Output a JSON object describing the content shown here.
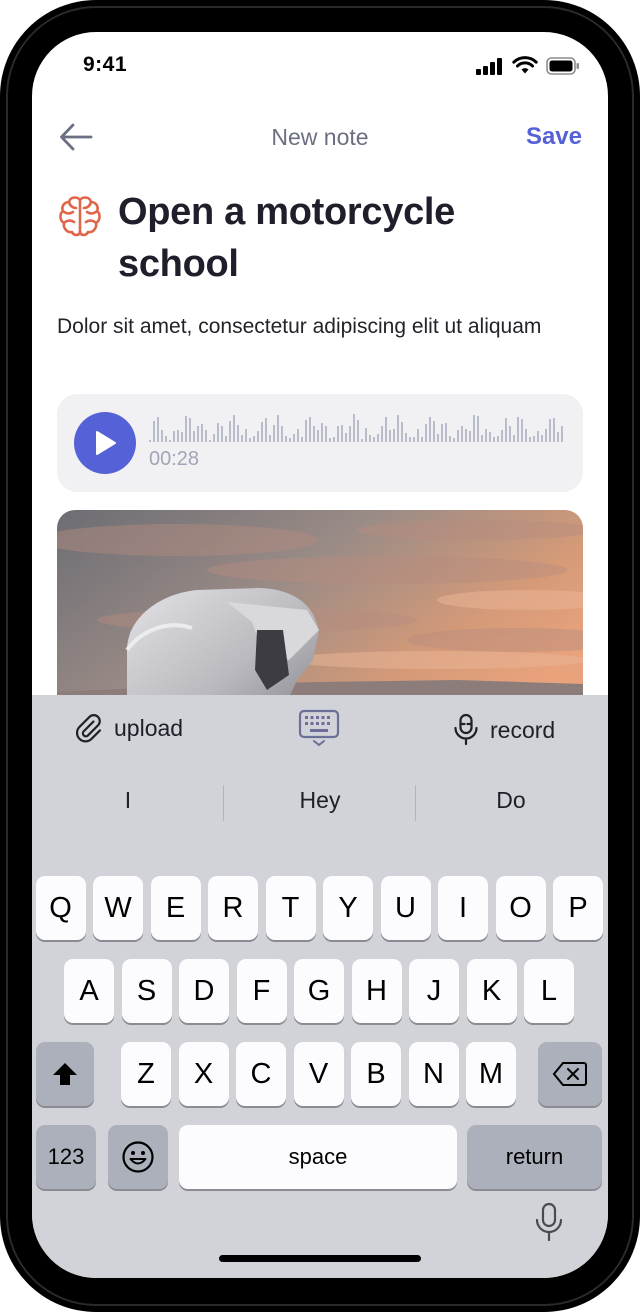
{
  "status_bar": {
    "time": "9:41"
  },
  "nav": {
    "title": "New note",
    "save_label": "Save"
  },
  "note": {
    "title": "Open a motorcycle school",
    "description": "Dolor sit amet, consectetur adipiscing elit ut aliquam"
  },
  "audio": {
    "duration": "00:28",
    "accent": "#5561d6"
  },
  "toolbar": {
    "upload_label": "upload",
    "record_label": "record"
  },
  "suggestions": [
    "I",
    "Hey",
    "Do"
  ],
  "keyboard": {
    "row1": [
      "Q",
      "W",
      "E",
      "R",
      "T",
      "Y",
      "U",
      "I",
      "O",
      "P"
    ],
    "row2": [
      "A",
      "S",
      "D",
      "F",
      "G",
      "H",
      "J",
      "K",
      "L"
    ],
    "row3": [
      "Z",
      "X",
      "C",
      "V",
      "B",
      "N",
      "M"
    ],
    "numbers_label": "123",
    "space_label": "space",
    "return_label": "return"
  },
  "icons": {
    "back": "arrow-left-icon",
    "category": "brain-icon",
    "upload": "paperclip-icon",
    "keyboard": "keyboard-icon",
    "record": "microphone-icon"
  }
}
